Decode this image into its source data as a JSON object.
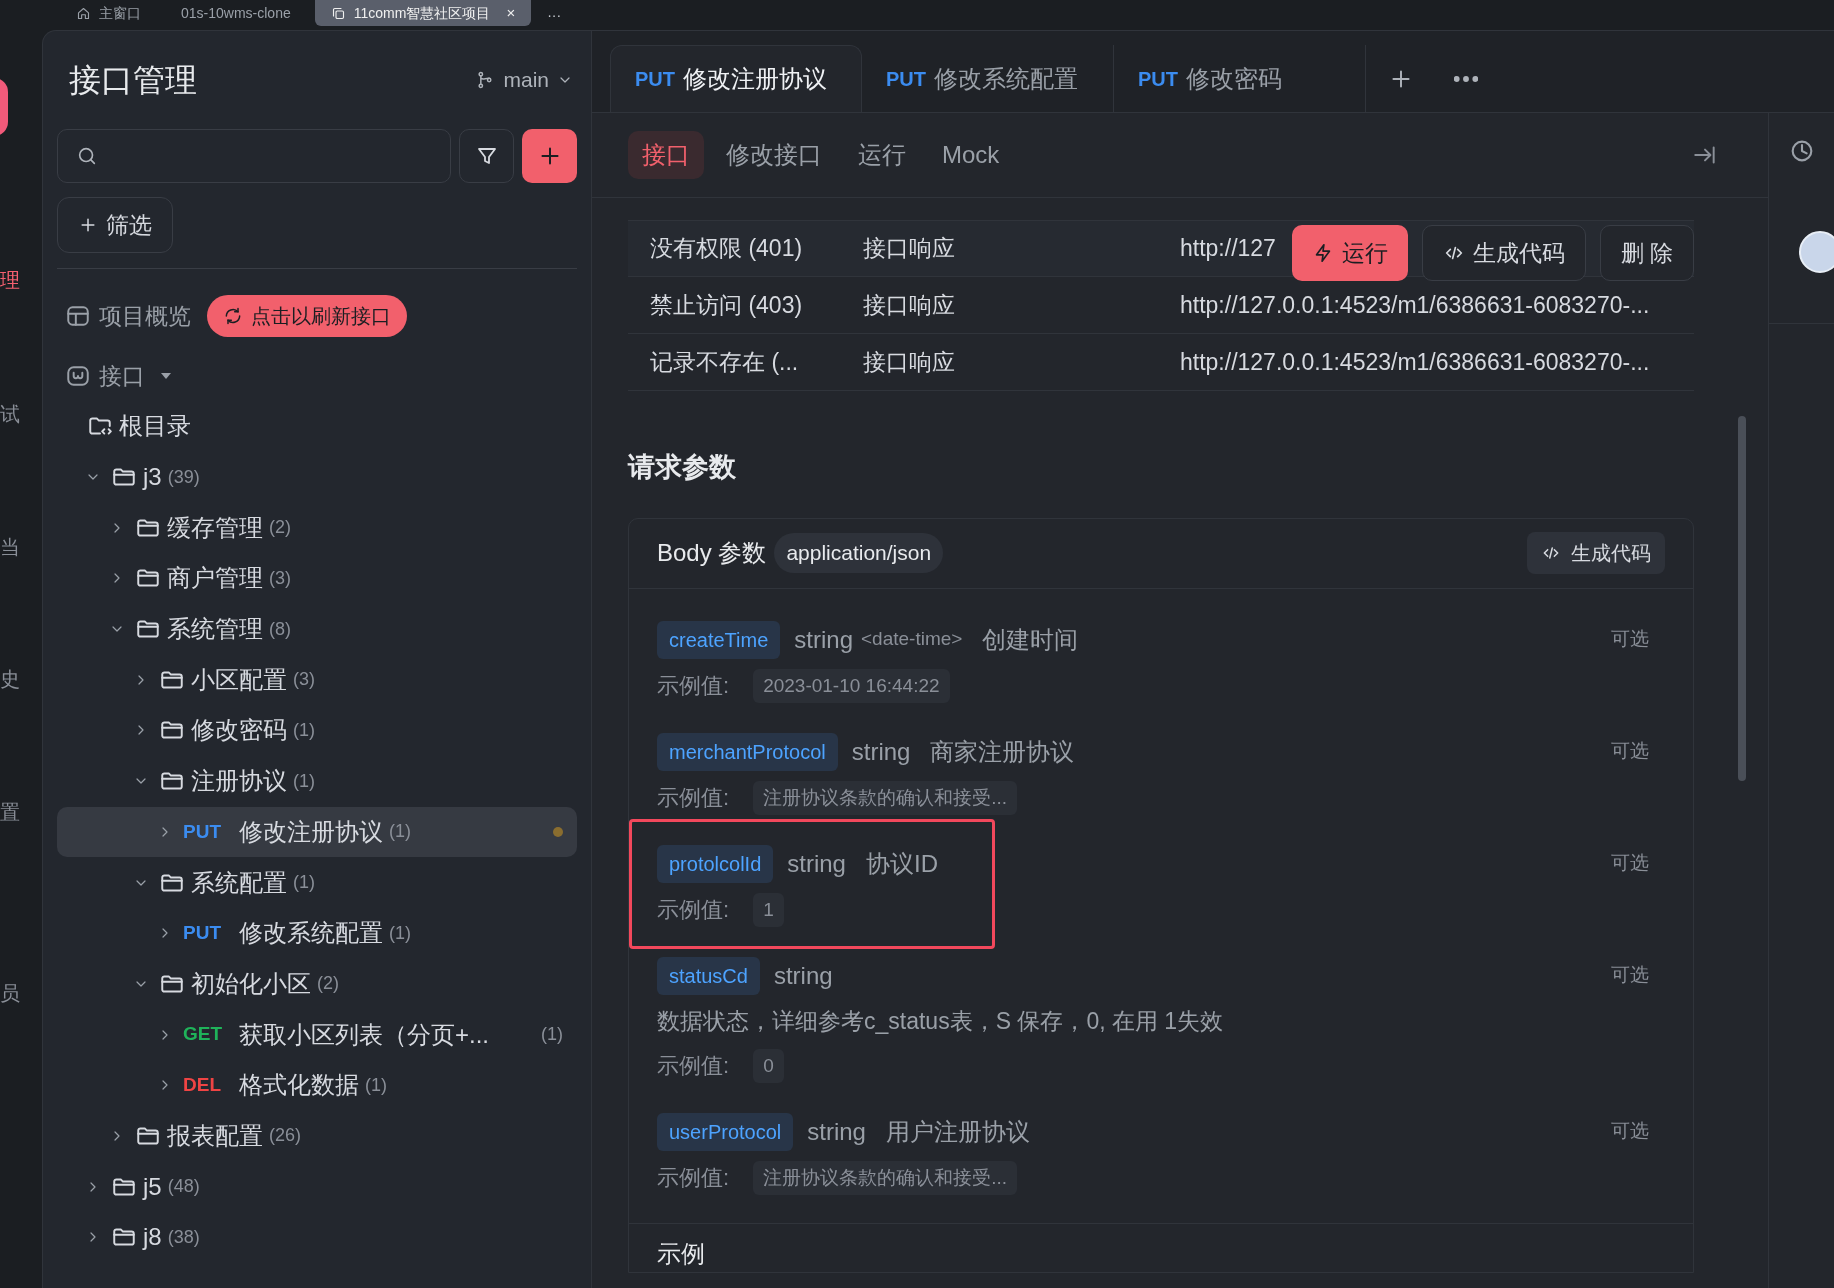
{
  "window_tabs": [
    {
      "label": "主窗口",
      "selected": false
    },
    {
      "label": "01s-10wms-clone",
      "selected": false
    },
    {
      "label": "11comm智慧社区项目",
      "selected": true,
      "close": "×"
    }
  ],
  "window_tabs_more": "···",
  "nav_rail": [
    {
      "label": "理",
      "selected": true
    },
    {
      "label": "试",
      "selected": false
    },
    {
      "label": "当",
      "selected": false
    },
    {
      "label": "史",
      "selected": false
    },
    {
      "label": "置",
      "selected": false
    },
    {
      "label": "员",
      "selected": false
    }
  ],
  "sidebar": {
    "title": "接口管理",
    "branch": "main",
    "filter_button": "筛选",
    "overview": "项目概览",
    "refresh_button": "点击以刷新接口",
    "section": "接口",
    "tree": [
      {
        "kind": "root",
        "name": "根目录"
      },
      {
        "kind": "folder",
        "name": "j3",
        "count": "(39)",
        "expanded": true,
        "children": [
          {
            "kind": "folder",
            "name": "缓存管理",
            "count": "(2)",
            "expanded": false
          },
          {
            "kind": "folder",
            "name": "商户管理",
            "count": "(3)",
            "expanded": false
          },
          {
            "kind": "folder",
            "name": "系统管理",
            "count": "(8)",
            "expanded": true,
            "children": [
              {
                "kind": "folder",
                "name": "小区配置",
                "count": "(3)",
                "expanded": false
              },
              {
                "kind": "folder",
                "name": "修改密码",
                "count": "(1)",
                "expanded": false
              },
              {
                "kind": "folder",
                "name": "注册协议",
                "count": "(1)",
                "expanded": true,
                "children": [
                  {
                    "kind": "api",
                    "method": "PUT",
                    "color": "#3b8cf0",
                    "name": "修改注册协议",
                    "count": "(1)",
                    "selected": true,
                    "modified": true
                  }
                ]
              },
              {
                "kind": "folder",
                "name": "系统配置",
                "count": "(1)",
                "expanded": true,
                "children": [
                  {
                    "kind": "api",
                    "method": "PUT",
                    "color": "#3b8cf0",
                    "name": "修改系统配置",
                    "count": "(1)",
                    "selected": false,
                    "modified": false
                  }
                ]
              },
              {
                "kind": "folder",
                "name": "初始化小区",
                "count": "(2)",
                "expanded": true,
                "children": [
                  {
                    "kind": "api",
                    "method": "GET",
                    "color": "#1fb35a",
                    "name": "获取小区列表（分页+...",
                    "count": "(1)",
                    "selected": false,
                    "modified": false
                  },
                  {
                    "kind": "api",
                    "method": "DEL",
                    "color": "#ef4444",
                    "name": "格式化数据",
                    "count": "(1)",
                    "selected": false,
                    "modified": false
                  }
                ]
              }
            ]
          },
          {
            "kind": "folder",
            "name": "报表配置",
            "count": "(26)",
            "expanded": false
          }
        ]
      },
      {
        "kind": "folder",
        "name": "j5",
        "count": "(48)",
        "expanded": false
      },
      {
        "kind": "folder",
        "name": "j8",
        "count": "(38)",
        "expanded": false
      }
    ]
  },
  "editor_tabs": [
    {
      "method": "PUT",
      "title": "修改注册协议",
      "selected": true
    },
    {
      "method": "PUT",
      "title": "修改系统配置",
      "selected": false
    },
    {
      "method": "PUT",
      "title": "修改密码",
      "selected": false
    }
  ],
  "sub_tabs": [
    {
      "label": "接口",
      "selected": true
    },
    {
      "label": "修改接口",
      "selected": false
    },
    {
      "label": "运行",
      "selected": false
    },
    {
      "label": "Mock",
      "selected": false
    }
  ],
  "responses": [
    {
      "name": "没有权限 (401)",
      "type": "接口响应",
      "url": "http://127",
      "hovered": true
    },
    {
      "name": "禁止访问 (403)",
      "type": "接口响应",
      "url": "http://127.0.0.1:4523/m1/6386631-6083270-...",
      "hovered": false
    },
    {
      "name": "记录不存在 (...",
      "type": "接口响应",
      "url": "http://127.0.0.1:4523/m1/6386631-6083270-...",
      "hovered": false
    }
  ],
  "row_actions": {
    "run": "运行",
    "generate": "生成代码",
    "delete": "删 除"
  },
  "request_params": {
    "title": "请求参数",
    "body_label": "Body 参数",
    "content_type": "application/json",
    "generate_button": "生成代码",
    "params": [
      {
        "kind": "inline",
        "name": "createTime",
        "type": "string",
        "format": "<date-time>",
        "description": "创建时间",
        "optional": "可选",
        "example_label": "示例值:",
        "example": "2023-01-10 16:44:22",
        "highlighted": false
      },
      {
        "kind": "inline",
        "name": "merchantProtocol",
        "type": "string",
        "description": "商家注册协议",
        "optional": "可选",
        "example_label": "示例值:",
        "example": "注册协议条款的确认和接受...",
        "highlighted": false
      },
      {
        "kind": "inline",
        "name": "protolcolId",
        "type": "string",
        "description": "协议ID",
        "optional": "可选",
        "example_label": "示例值:",
        "example": "1",
        "highlighted": true
      },
      {
        "kind": "block",
        "name": "statusCd",
        "type": "string",
        "description": "数据状态，详细参考c_status表，S 保存，0, 在用 1失效",
        "optional": "可选",
        "example_label": "示例值:",
        "example": "0",
        "highlighted": false
      },
      {
        "kind": "inline",
        "name": "userProtocol",
        "type": "string",
        "description": "用户注册协议",
        "optional": "可选",
        "example_label": "示例值:",
        "example": "注册协议条款的确认和接受...",
        "highlighted": false
      }
    ]
  },
  "example_title": "示例"
}
